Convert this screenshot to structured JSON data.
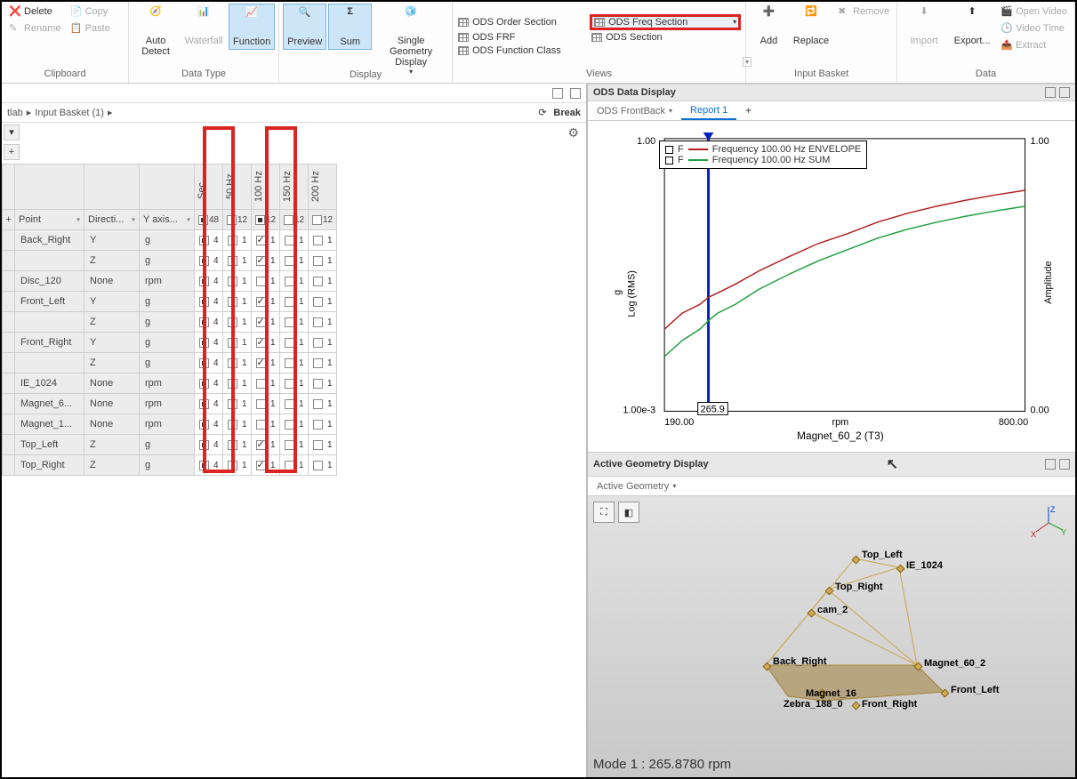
{
  "ribbon": {
    "clipboard": {
      "label": "Clipboard",
      "delete": "Delete",
      "rename": "Rename",
      "copy": "Copy",
      "paste": "Paste"
    },
    "datatype": {
      "label": "Data Type",
      "auto_detect": "Auto Detect",
      "waterfall": "Waterfall",
      "function": "Function"
    },
    "display_grp": {
      "label": "Display",
      "preview": "Preview",
      "sum": "Sum",
      "single_geom": "Single Geometry Display"
    },
    "views": {
      "label": "Views",
      "order": "ODS Order Section",
      "freq": "ODS Freq Section",
      "frf": "ODS FRF",
      "section": "ODS Section",
      "funcclass": "ODS Function Class"
    },
    "input_basket": {
      "label": "Input Basket",
      "add": "Add",
      "replace": "Replace",
      "remove": "Remove"
    },
    "data_grp": {
      "label": "Data",
      "import": "Import",
      "export": "Export...",
      "open_video": "Open Video",
      "video_time": "Video Time",
      "extract": "Extract"
    }
  },
  "left_panel": {
    "breadcrumb": [
      "tlab",
      "Input Basket (1)"
    ],
    "break_btn": "Break",
    "columns_rot": [
      "Sec...",
      "50 Hz",
      "100 Hz",
      "150 Hz",
      "200 Hz"
    ],
    "headers": [
      "Point",
      "Directi...",
      "Y axis...",
      "48",
      "12",
      "12",
      "12",
      "12"
    ],
    "rows": [
      {
        "point": "Back_Right",
        "dir": "Y",
        "yax": "g",
        "sec": "4",
        "c100": true
      },
      {
        "point": "",
        "dir": "Z",
        "yax": "g",
        "sec": "4",
        "c100": true
      },
      {
        "point": "Disc_120",
        "dir": "None",
        "yax": "rpm",
        "sec": "4",
        "c100": false
      },
      {
        "point": "Front_Left",
        "dir": "Y",
        "yax": "g",
        "sec": "4",
        "c100": true
      },
      {
        "point": "",
        "dir": "Z",
        "yax": "g",
        "sec": "4",
        "c100": true
      },
      {
        "point": "Front_Right",
        "dir": "Y",
        "yax": "g",
        "sec": "4",
        "c100": true
      },
      {
        "point": "",
        "dir": "Z",
        "yax": "g",
        "sec": "4",
        "c100": true
      },
      {
        "point": "IE_1024",
        "dir": "None",
        "yax": "rpm",
        "sec": "4",
        "c100": false
      },
      {
        "point": "Magnet_6...",
        "dir": "None",
        "yax": "rpm",
        "sec": "4",
        "c100": false
      },
      {
        "point": "Magnet_1...",
        "dir": "None",
        "yax": "rpm",
        "sec": "4",
        "c100": false
      },
      {
        "point": "Top_Left",
        "dir": "Z",
        "yax": "g",
        "sec": "4",
        "c100": true
      },
      {
        "point": "Top_Right",
        "dir": "Z",
        "yax": "g",
        "sec": "4",
        "c100": true
      }
    ]
  },
  "ods_display": {
    "title": "ODS Data Display",
    "combo": "ODS FrontBack",
    "report_tab": "Report 1"
  },
  "chart_data": {
    "type": "line",
    "title": "Magnet_60_2 (T3)",
    "xlabel": "rpm",
    "ylabel_left": "g",
    "ylabel_left2": "Log (RMS)",
    "ylabel_right": "Amplitude",
    "xlim": [
      190,
      800
    ],
    "ylim_left": [
      0.001,
      1.0
    ],
    "ylim_right": [
      0.0,
      1.0
    ],
    "ytick_left_top": "1.00",
    "ytick_left_bot": "1.00e-3",
    "ytick_right_top": "1.00",
    "ytick_right_bot": "0.00",
    "xtick_left": "190.00",
    "xtick_right": "800.00",
    "cursor_x": 265.9,
    "cursor_label": "265.9",
    "series": [
      {
        "name": "F",
        "desc": "Frequency 100.00 Hz ENVELOPE",
        "color": "#b02020",
        "x": [
          190,
          220,
          250,
          265,
          280,
          310,
          350,
          400,
          450,
          500,
          550,
          600,
          650,
          700,
          750,
          800
        ],
        "y": [
          0.008,
          0.012,
          0.015,
          0.018,
          0.02,
          0.025,
          0.035,
          0.05,
          0.07,
          0.09,
          0.12,
          0.15,
          0.18,
          0.21,
          0.24,
          0.27
        ]
      },
      {
        "name": "F",
        "desc": "Frequency 100.00 Hz SUM",
        "color": "#20a040",
        "x": [
          190,
          220,
          250,
          265,
          280,
          310,
          350,
          400,
          450,
          500,
          550,
          600,
          650,
          700,
          750,
          800
        ],
        "y": [
          0.004,
          0.006,
          0.008,
          0.01,
          0.012,
          0.015,
          0.022,
          0.032,
          0.045,
          0.06,
          0.08,
          0.1,
          0.12,
          0.14,
          0.16,
          0.18
        ]
      }
    ]
  },
  "geom": {
    "title": "Active Geometry Display",
    "combo": "Active Geometry",
    "mode": "Mode  1 : 265.8780 rpm",
    "nodes": [
      "Top_Left",
      "IE_1024",
      "Top_Right",
      "cam_2",
      "Back_Right",
      "Magnet_60_2",
      "Magnet_16",
      "Zebra_188_0",
      "Front_Left",
      "Front_Right"
    ],
    "axes": [
      "X",
      "Y",
      "Z"
    ]
  }
}
